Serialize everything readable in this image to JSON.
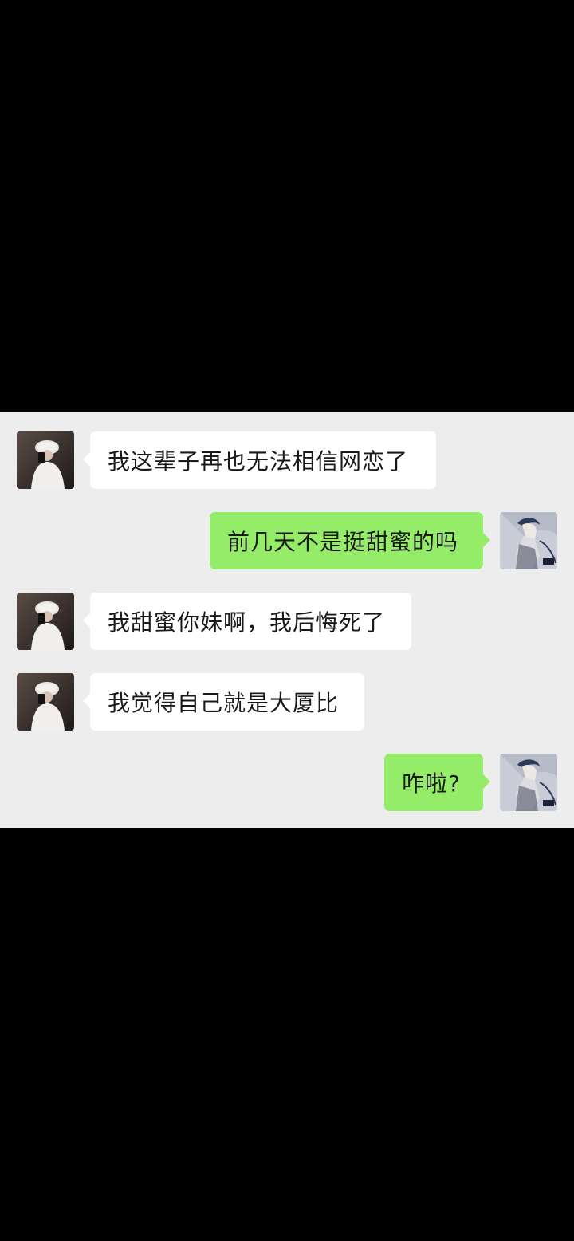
{
  "colors": {
    "chat_background": "#ededed",
    "incoming_bubble": "#ffffff",
    "outgoing_bubble": "#95ec69",
    "letterbox": "#000000"
  },
  "contact": {
    "avatar_icon": "person-white-hat-photo"
  },
  "me": {
    "avatar_icon": "anime-character-avatar"
  },
  "messages": [
    {
      "side": "incoming",
      "text": "我这辈子再也无法相信网恋了"
    },
    {
      "side": "outgoing",
      "text": "前几天不是挺甜蜜的吗"
    },
    {
      "side": "incoming",
      "text": "我甜蜜你妹啊，我后悔死了"
    },
    {
      "side": "incoming",
      "text": "我觉得自己就是大厦比"
    },
    {
      "side": "outgoing",
      "text": "咋啦?"
    }
  ]
}
